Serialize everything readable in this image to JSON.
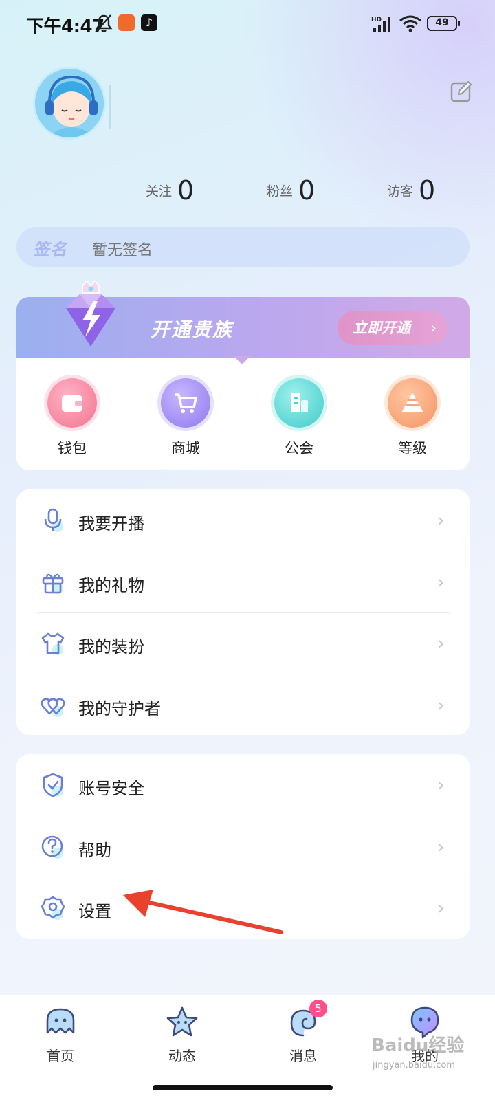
{
  "status_bar": {
    "time": "下午4:47",
    "battery": "49"
  },
  "profile": {
    "stats": [
      {
        "label": "关注",
        "value": "0"
      },
      {
        "label": "粉丝",
        "value": "0"
      },
      {
        "label": "访客",
        "value": "0"
      }
    ],
    "signature": {
      "tag": "签名",
      "text": "暂无签名"
    }
  },
  "noble_banner": {
    "title": "开通贵族",
    "button_label": "立即开通",
    "button_chevron": "›"
  },
  "quick_actions": [
    {
      "label": "钱包",
      "icon": "wallet-icon"
    },
    {
      "label": "商城",
      "icon": "shopping-cart-icon"
    },
    {
      "label": "公会",
      "icon": "building-icon"
    },
    {
      "label": "等级",
      "icon": "level-pyramid-icon"
    }
  ],
  "menu_group_1": [
    {
      "label": "我要开播",
      "icon": "microphone-icon"
    },
    {
      "label": "我的礼物",
      "icon": "gift-icon"
    },
    {
      "label": "我的装扮",
      "icon": "shirt-icon"
    },
    {
      "label": "我的守护者",
      "icon": "hearts-icon"
    }
  ],
  "menu_group_2": [
    {
      "label": "账号安全",
      "icon": "shield-check-icon"
    },
    {
      "label": "帮助",
      "icon": "help-icon"
    },
    {
      "label": "设置",
      "icon": "gear-icon"
    }
  ],
  "chevron": "›",
  "bottom_nav": [
    {
      "label": "首页",
      "icon": "home-ghost-icon"
    },
    {
      "label": "动态",
      "icon": "star-icon"
    },
    {
      "label": "消息",
      "icon": "message-icon",
      "badge": "5"
    },
    {
      "label": "我的",
      "icon": "mine-icon"
    }
  ],
  "watermark": {
    "brand": "Baidu经验",
    "url": "jingyan.baidu.com"
  },
  "colors": {
    "accent_pink": "#ff4f8b",
    "annotation_arrow": "#e8412e",
    "banner_start": "#9ab0ef",
    "banner_end": "#d2a9e7"
  }
}
